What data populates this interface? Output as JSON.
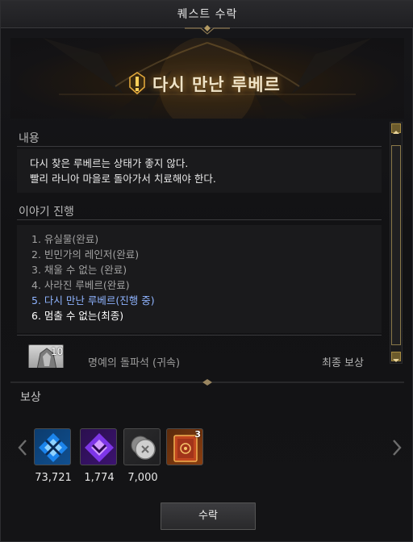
{
  "window": {
    "title": "퀘스트 수락"
  },
  "quest": {
    "title": "다시 만난 루베르"
  },
  "sections": {
    "content_label": "내용",
    "story_label": "이야기 진행",
    "rewards_label": "보상"
  },
  "description": {
    "line1": "다시 찾은 루베르는 상태가 좋지 않다.",
    "line2": "빨리 라니아 마을로 돌아가서 치료해야 한다."
  },
  "progress": [
    {
      "text": "1. 유실물(완료)",
      "state": "done"
    },
    {
      "text": "2. 빈민가의 레인저(완료)",
      "state": "done"
    },
    {
      "text": "3. 채울 수 없는 (완료)",
      "state": "done"
    },
    {
      "text": "4. 사라진 루베르(완료)",
      "state": "done"
    },
    {
      "text": "5. 다시 만난 루베르(진행 중)",
      "state": "active"
    },
    {
      "text": "6. 멈출 수 없는(최종)",
      "state": "final"
    }
  ],
  "final_reward": {
    "count": "10",
    "name": "명예의 돌파석 (귀속)",
    "label": "최종 보상",
    "icon": "stone-icon"
  },
  "rewards": [
    {
      "icon": "blue-crystal-icon",
      "value": "73,721",
      "color": "#1e8fff"
    },
    {
      "icon": "purple-crystal-icon",
      "value": "1,774",
      "color": "#8b3dff"
    },
    {
      "icon": "silver-coin-icon",
      "value": "7,000",
      "color": "#b8b8b8"
    },
    {
      "icon": "book-icon",
      "value": "",
      "badge": "3",
      "color": "#c0451e"
    }
  ],
  "buttons": {
    "accept": "수락"
  },
  "colors": {
    "accent_gold": "#a88d43",
    "active_blue": "#8fb4ff"
  }
}
